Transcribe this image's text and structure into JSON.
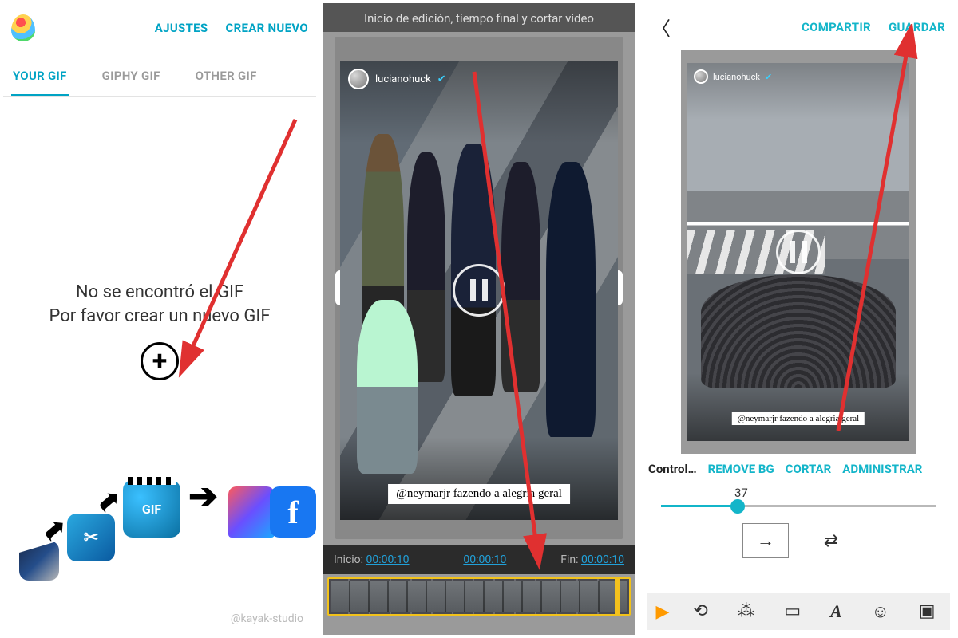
{
  "panel1": {
    "top_links": {
      "settings": "AJUSTES",
      "create_new": "CREAR NUEVO"
    },
    "tabs": [
      {
        "id": "your",
        "label": "YOUR GIF",
        "active": true
      },
      {
        "id": "giphy",
        "label": "GIPHY GIF",
        "active": false
      },
      {
        "id": "other",
        "label": "OTHER GIF",
        "active": false
      }
    ],
    "empty_msg_line1": "No se encontró el GIF",
    "empty_msg_line2": "Por favor crear un nuevo GIF",
    "gif_badge": "GIF",
    "credit": "@kayak-studio"
  },
  "panel2": {
    "hint": "Inicio de edición, tiempo final y cortar video",
    "story_user": "lucianohuck",
    "caption": "@neymarjr fazendo a alegria geral",
    "time_labels": {
      "start": "Inicio:",
      "end": "Fin:"
    },
    "time_values": {
      "start": "00:00:10",
      "mid": "00:00:10",
      "end": "00:00:10"
    }
  },
  "panel3": {
    "top_links": {
      "share": "COMPARTIR",
      "save": "GUARDAR"
    },
    "story_user": "lucianohuck",
    "caption": "@neymarjr fazendo a alegria geral",
    "controls": {
      "label": "Control…",
      "remove_bg": "REMOVE BG",
      "cut": "CORTAR",
      "manage": "ADMINISTRAR"
    },
    "slider_value": "37"
  }
}
